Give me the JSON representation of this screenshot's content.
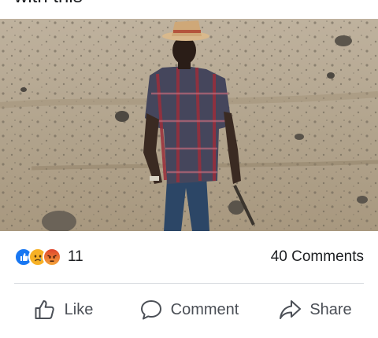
{
  "post": {
    "caption": "with this",
    "photo_alt": "Man in a plaid shirt and straw hat walking on rocky terrain"
  },
  "reactions": {
    "icons": [
      "like-icon",
      "sad-icon",
      "angry-icon"
    ],
    "count": "11",
    "colors": {
      "like": "#1877f2",
      "sad": "#f7b125",
      "angry": "#e9710f"
    }
  },
  "comments": {
    "label": "40 Comments"
  },
  "actions": [
    {
      "label": "Like",
      "icon": "thumbs-up-icon"
    },
    {
      "label": "Comment",
      "icon": "comment-bubble-icon"
    },
    {
      "label": "Share",
      "icon": "share-arrow-icon"
    }
  ]
}
